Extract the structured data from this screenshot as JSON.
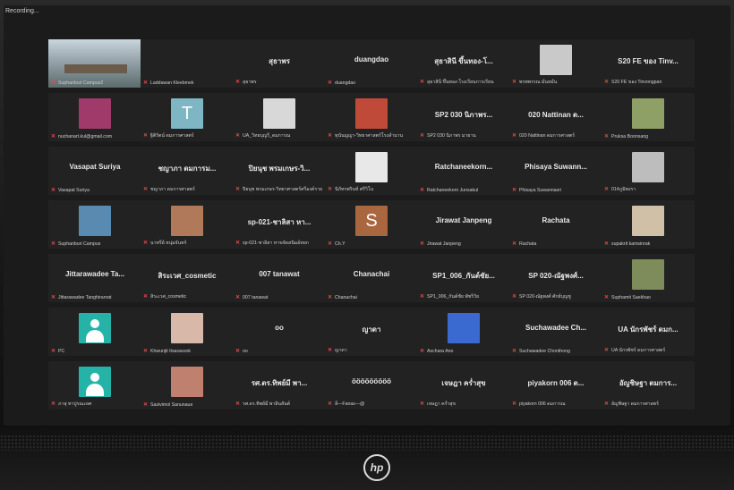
{
  "recording_label": "Recording...",
  "colors": {
    "mic_muted": "#e34b4b",
    "active_border": "#c9e28a",
    "tile_bg": "#222222"
  },
  "tiles": [
    {
      "label": "Suphanburi Campus2",
      "avatar": "video",
      "active": true
    },
    {
      "label": "Laddawan Kleebmek",
      "avatar": "none",
      "title": ""
    },
    {
      "label": "สุธาพร",
      "title": "สุธาพร"
    },
    {
      "label": "duangdao",
      "title": "duangdao"
    },
    {
      "label": "สุธาสินี ขึ้นทอง-โรงเรียนการเรียน",
      "title": "สุธาสินี ขึ้นทอง-โ..."
    },
    {
      "label": "พรทพรรณ มั่นหมั่น",
      "avatar": "photo",
      "photo_color": "#c9c9c9"
    },
    {
      "label": "S20 FE ของ Tinvongpan",
      "title": "S20 FE ของ Tinv..."
    },
    {
      "label": "nuchanart.kul@gmail.com",
      "avatar": "photo",
      "photo_color": "#a03a6a"
    },
    {
      "label": "ฐิติรัตน์ ดมการศาสตร์",
      "avatar": "letter",
      "letter": "T",
      "letter_bg": "#7fb6c4"
    },
    {
      "label": "UA_วิทยบุญรี_ดมการณ",
      "avatar": "photo",
      "photo_color": "#d8d8d8"
    },
    {
      "label": "ทุนันญญา-วิทยาศาสตร์โรงลำนาน",
      "avatar": "photo",
      "photo_color": "#c04a3a"
    },
    {
      "label": "SP2 030 นิภาพร มายาน",
      "title": "SP2 030 นิภาพร..."
    },
    {
      "label": "020 Nattinan ดมการศาสตร์",
      "title": "020 Nattinan ด..."
    },
    {
      "label": "Pruksa Boonsang",
      "avatar": "photo",
      "photo_color": "#8fa066"
    },
    {
      "label": "Vasapat Suriya",
      "title": "Vasapat Suriya"
    },
    {
      "label": "ชญาภา ดมการศาสตร์",
      "title": "ชญาภา ดมการม..."
    },
    {
      "label": "ปิยนุช พรมเกษร-วิทยาศาสตร์ศรีองค์ราย",
      "title": "ปิยนุช พรมเกษร-วิ..."
    },
    {
      "label": "นิภัทรพรินท์ ศรีวิโน",
      "avatar": "photo",
      "photo_color": "#e8e8e8"
    },
    {
      "label": "Ratchaneekorn Junsakul",
      "title": "Ratchaneekorn..."
    },
    {
      "label": "Phisaya Suwannasri",
      "title": "Phisaya Suwann..."
    },
    {
      "label": "014ภูมิพงรา",
      "avatar": "photo",
      "photo_color": "#bdbdbd"
    },
    {
      "label": "Suphanburi Campus",
      "avatar": "photo",
      "photo_color": "#5a8ab0"
    },
    {
      "label": "นาทรีย์ หนุ่มจันทร์",
      "avatar": "photo",
      "photo_color": "#b07a5a"
    },
    {
      "label": "sp-021-ชาลิสา หาขจัดสนิมอ์ทยก",
      "title": "sp-021-ชาลิสา หา..."
    },
    {
      "label": "Ch.Y",
      "avatar": "letter",
      "letter": "S",
      "letter_bg": "#a8673f"
    },
    {
      "label": "Jirawat Janpeng",
      "title": "Jirawat Janpeng"
    },
    {
      "label": "Rachata",
      "title": "Rachata"
    },
    {
      "label": "supakrit kamsinrak",
      "avatar": "photo",
      "photo_color": "#d0c0a8"
    },
    {
      "label": "Jittarawadee Tanghiranrat",
      "title": "Jittarawadee Ta..."
    },
    {
      "label": "สิระเวศ_cosmetic",
      "title": "สิระเวศ_cosmetic"
    },
    {
      "label": "007 tanawat",
      "title": "007 tanawat"
    },
    {
      "label": "Chanachai",
      "title": "Chanachai"
    },
    {
      "label": "SP1_006_กันต์ชัย พัชรีวัย",
      "title": "SP1_006_กันต์ชัย..."
    },
    {
      "label": "SP 020-ณัฐพงศ์ ศักย์บุญชู",
      "title": "SP 020-ณัฐพงศ์..."
    },
    {
      "label": "Suphamit Saekhao",
      "avatar": "photo",
      "photo_color": "#7d8c5a"
    },
    {
      "label": "PC",
      "avatar": "person"
    },
    {
      "label": "Khwunjit Itsarasook",
      "avatar": "photo",
      "photo_color": "#d8b8a8"
    },
    {
      "label": "oo",
      "title": "oo"
    },
    {
      "label": "ญาดา",
      "title": "ญาดา"
    },
    {
      "label": "Aschara Ano",
      "avatar": "photo",
      "photo_color": "#3a6ad0"
    },
    {
      "label": "Suchawadee Chonthong",
      "title": "Suchawadee Ch..."
    },
    {
      "label": "UA นักรพัชร์ ดมการศาสตร์",
      "title": "UA นักรพัชร์ ดมก..."
    },
    {
      "label": "ภาสุ ทาปูรณะยศ",
      "avatar": "person"
    },
    {
      "label": "Sasivimol Sanunaue",
      "avatar": "photo",
      "photo_color": "#c08070"
    },
    {
      "label": "รศ.ดร.ทิพย์มี พาลินสันต์",
      "title": "รศ.ดร.ทิพย์มี พา..."
    },
    {
      "label": "ลี—Fanas—@",
      "title": "ööööööööö"
    },
    {
      "label": "เจษฎา คร่ำสุข",
      "title": "เจษฎา คร่ำสุข"
    },
    {
      "label": "piyakorn 006 ดมการณ",
      "title": "piyakorn 006 ด..."
    },
    {
      "label": "อัญชิษฐา ดมการศาสตร์",
      "title": "อัญชิษฐา ดมการ..."
    }
  ]
}
